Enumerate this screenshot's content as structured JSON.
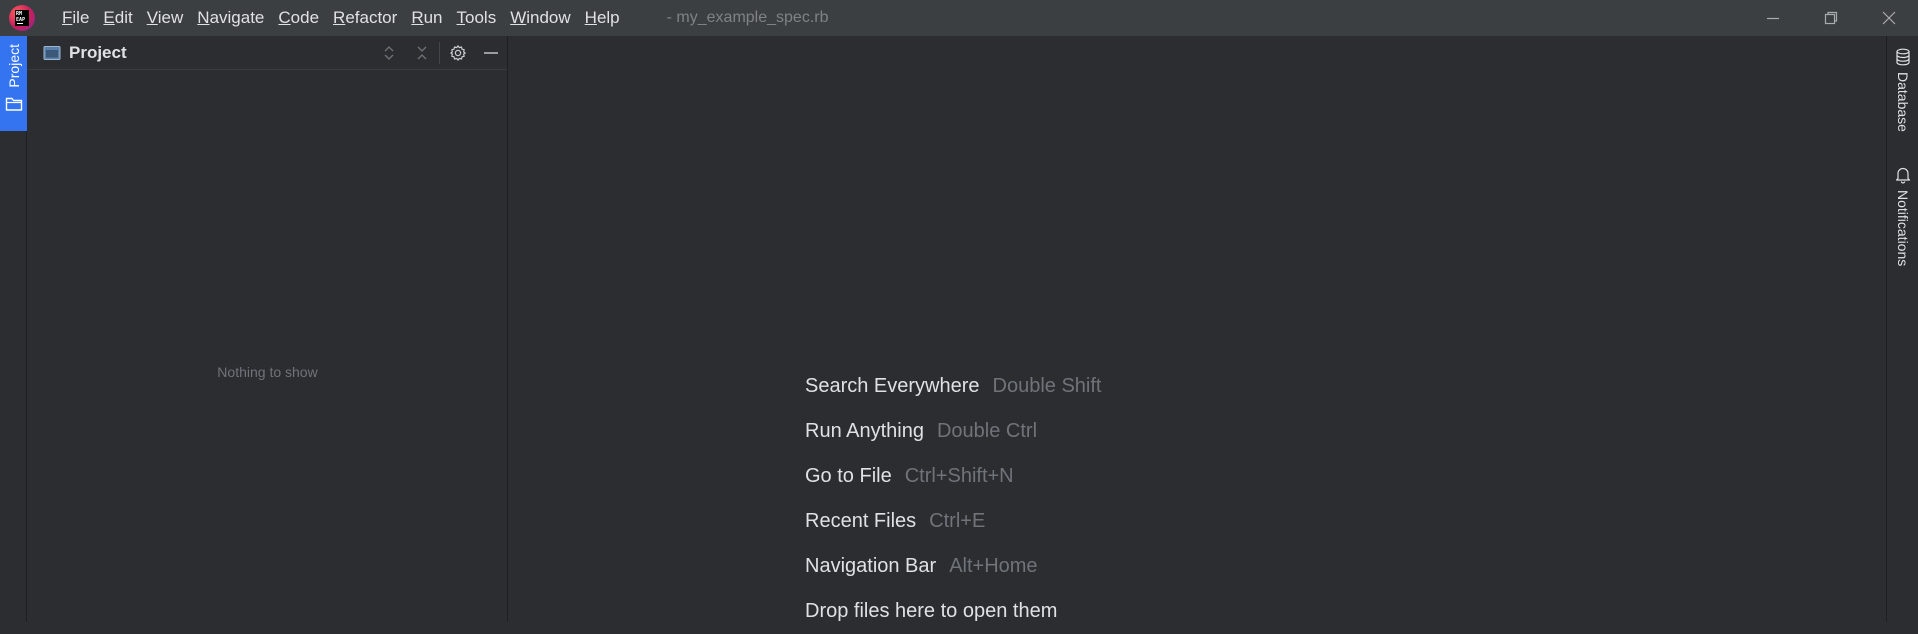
{
  "app": {
    "logo_text": "RM EAP",
    "window_title": "- my_example_spec.rb"
  },
  "menu": [
    {
      "label": "File",
      "mnemonic": "F",
      "rest": "ile"
    },
    {
      "label": "Edit",
      "mnemonic": "E",
      "rest": "dit"
    },
    {
      "label": "View",
      "mnemonic": "V",
      "rest": "iew"
    },
    {
      "label": "Navigate",
      "mnemonic": "N",
      "rest": "avigate"
    },
    {
      "label": "Code",
      "mnemonic": "C",
      "rest": "ode"
    },
    {
      "label": "Refactor",
      "mnemonic": "R",
      "rest": "efactor"
    },
    {
      "label": "Run",
      "mnemonic": "R",
      "rest": "un",
      "pre": "",
      "underline_index": 2
    },
    {
      "label": "Tools",
      "mnemonic": "T",
      "rest": "ools"
    },
    {
      "label": "Window",
      "mnemonic": "W",
      "rest": "indow"
    },
    {
      "label": "Help",
      "mnemonic": "H",
      "rest": "elp"
    }
  ],
  "left_stripe": {
    "project_label": "Project"
  },
  "project_panel": {
    "title": "Project",
    "empty_text": "Nothing to show"
  },
  "editor": {
    "hints": [
      {
        "action": "Search Everywhere",
        "shortcut": "Double Shift"
      },
      {
        "action": "Run Anything",
        "shortcut": "Double Ctrl"
      },
      {
        "action": "Go to File",
        "shortcut": "Ctrl+Shift+N"
      },
      {
        "action": "Recent Files",
        "shortcut": "Ctrl+E"
      },
      {
        "action": "Navigation Bar",
        "shortcut": "Alt+Home"
      },
      {
        "action": "Drop files here to open them",
        "shortcut": ""
      }
    ]
  },
  "right_stripe": {
    "database_label": "Database",
    "notifications_label": "Notifications"
  },
  "colors": {
    "accent": "#3574f0",
    "background": "#2b2d30",
    "titlebar": "#3c3f41",
    "text": "#dfe1e5",
    "muted_text": "#6f737a"
  },
  "icons": {
    "app_logo": "rubymine-logo-icon",
    "minimize": "minimize-icon",
    "restore": "restore-icon",
    "close": "close-icon",
    "folder": "folder-icon",
    "panel": "project-window-icon",
    "expand_collapse": "expand-collapse-icon",
    "collapse_all": "collapse-all-icon",
    "settings": "gear-icon",
    "hide": "hide-icon",
    "database": "database-icon",
    "notifications": "bell-icon"
  }
}
